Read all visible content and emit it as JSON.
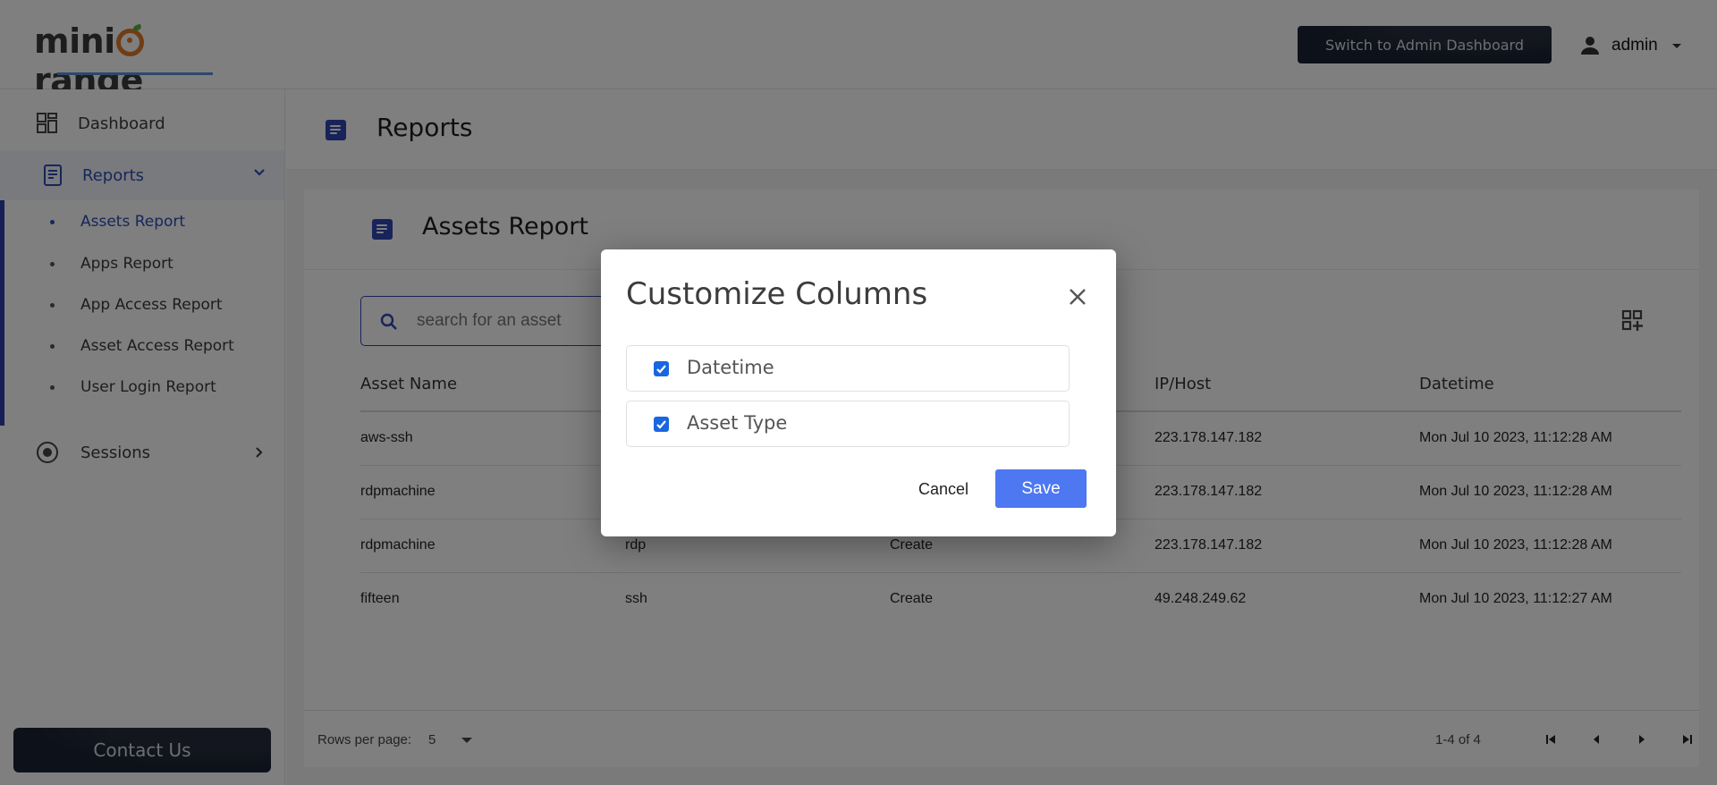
{
  "header": {
    "logo_text_pre": "mini",
    "logo_text_post": "range",
    "switch_button_label": "Switch to Admin Dashboard",
    "user_name": "admin"
  },
  "sidebar": {
    "items": [
      {
        "label": "Dashboard",
        "icon": "dashboard-grid-icon"
      },
      {
        "label": "Reports",
        "icon": "report-icon",
        "expanded": true
      },
      {
        "label": "Sessions",
        "icon": "radio-target-icon",
        "expanded": false
      }
    ],
    "report_subitems": [
      {
        "label": "Assets Report",
        "active": true
      },
      {
        "label": "Apps Report",
        "active": false
      },
      {
        "label": "App Access Report",
        "active": false
      },
      {
        "label": "Asset Access Report",
        "active": false
      },
      {
        "label": "User Login Report",
        "active": false
      }
    ],
    "contact_button_label": "Contact Us"
  },
  "main": {
    "page_title": "Reports",
    "card_title": "Assets Report",
    "search": {
      "placeholder": "search for an asset",
      "value": ""
    },
    "table": {
      "visible_headers": [
        "Asset Name",
        "",
        "",
        "IP/Host",
        "Datetime"
      ],
      "rows": [
        [
          "aws-ssh",
          "",
          "",
          "223.178.147.182",
          "Mon Jul 10 2023, 11:12:28 AM"
        ],
        [
          "rdpmachine",
          "",
          "",
          "223.178.147.182",
          "Mon Jul 10 2023, 11:12:28 AM"
        ],
        [
          "rdpmachine",
          "rdp",
          "Create",
          "223.178.147.182",
          "Mon Jul 10 2023, 11:12:28 AM"
        ],
        [
          "fifteen",
          "ssh",
          "Create",
          "49.248.249.62",
          "Mon Jul 10 2023, 11:12:27 AM"
        ]
      ]
    },
    "pagination": {
      "rows_per_page_label": "Rows per page:",
      "rows_per_page_value": "5",
      "range_text": "1-4 of 4"
    }
  },
  "modal": {
    "title": "Customize Columns",
    "options": [
      {
        "label": "Datetime",
        "checked": true
      },
      {
        "label": "Asset Type",
        "checked": true
      }
    ],
    "cancel_label": "Cancel",
    "save_label": "Save"
  },
  "colors": {
    "brand_blue": "#2f46b5",
    "accent_orange": "#e07b28",
    "dark_button": "#1b2232",
    "save_button": "#4d78f2",
    "checkbox": "#1a66e0"
  }
}
